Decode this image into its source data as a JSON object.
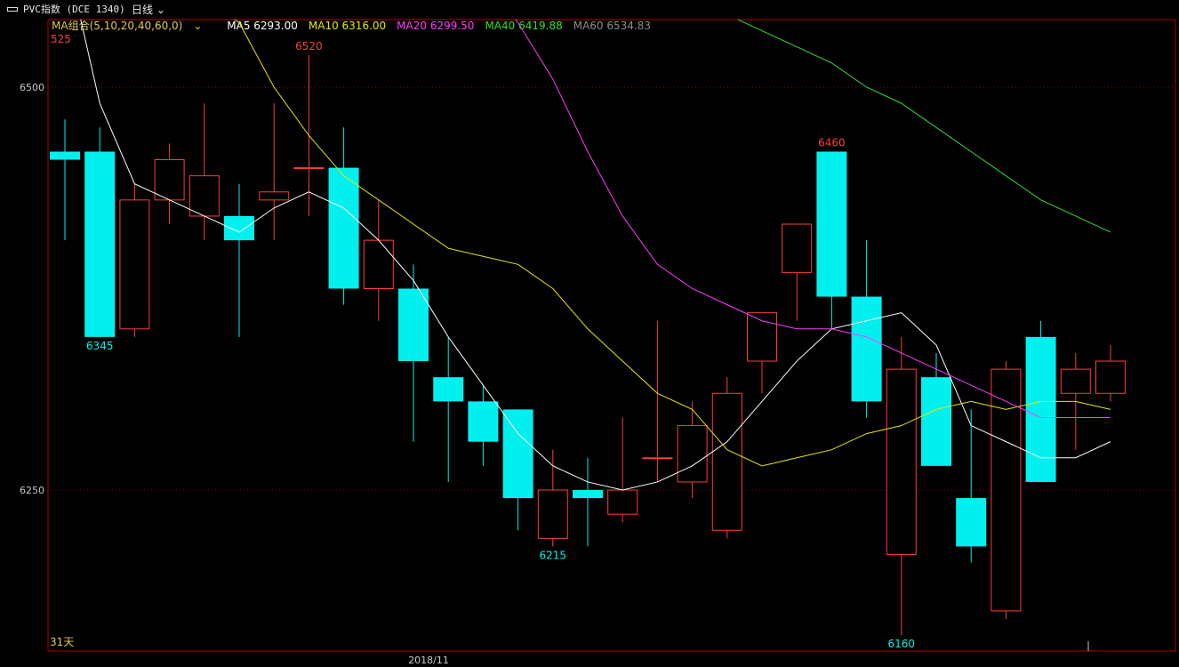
{
  "title_bar": {
    "symbol": "PVC指数 (DCE 1340)",
    "period": "日线"
  },
  "ma_bar": {
    "combo": "MA组合(5,10,20,40,60,0)",
    "items": [
      {
        "label": "MA5 6293.00",
        "color": "#ffffff"
      },
      {
        "label": "MA10 6316.00",
        "color": "#e6e600"
      },
      {
        "label": "MA20 6299.50",
        "color": "#ff3cff"
      },
      {
        "label": "MA40 6419.88",
        "color": "#32dc32"
      },
      {
        "label": "MA60 6534.83",
        "color": "#8c8c8c"
      }
    ]
  },
  "chart_data": {
    "type": "candlestick",
    "y_ticks": [
      6500,
      6250
    ],
    "ylim": [
      6150,
      6560
    ],
    "x_label": "2018/11",
    "days_label": "31天",
    "truncated_high_label": "525",
    "up_color": "#ff3c3c",
    "down_color": "#00f0f0",
    "candles": [
      {
        "o": 6460,
        "h": 6480,
        "l": 6405,
        "c": 6455
      },
      {
        "o": 6460,
        "h": 6475,
        "l": 6345,
        "c": 6345
      },
      {
        "o": 6350,
        "h": 6440,
        "l": 6345,
        "c": 6430
      },
      {
        "o": 6430,
        "h": 6465,
        "l": 6415,
        "c": 6455
      },
      {
        "o": 6420,
        "h": 6490,
        "l": 6405,
        "c": 6445
      },
      {
        "o": 6420,
        "h": 6440,
        "l": 6345,
        "c": 6405
      },
      {
        "o": 6430,
        "h": 6490,
        "l": 6405,
        "c": 6435
      },
      {
        "o": 6450,
        "h": 6520,
        "l": 6420,
        "c": 6450
      },
      {
        "o": 6450,
        "h": 6475,
        "l": 6365,
        "c": 6375
      },
      {
        "o": 6375,
        "h": 6430,
        "l": 6355,
        "c": 6405
      },
      {
        "o": 6375,
        "h": 6390,
        "l": 6280,
        "c": 6330
      },
      {
        "o": 6320,
        "h": 6345,
        "l": 6255,
        "c": 6305
      },
      {
        "o": 6305,
        "h": 6315,
        "l": 6265,
        "c": 6280
      },
      {
        "o": 6300,
        "h": 6300,
        "l": 6225,
        "c": 6245
      },
      {
        "o": 6220,
        "h": 6275,
        "l": 6215,
        "c": 6250
      },
      {
        "o": 6250,
        "h": 6270,
        "l": 6215,
        "c": 6245
      },
      {
        "o": 6235,
        "h": 6295,
        "l": 6230,
        "c": 6250
      },
      {
        "o": 6270,
        "h": 6355,
        "l": 6255,
        "c": 6270
      },
      {
        "o": 6255,
        "h": 6305,
        "l": 6245,
        "c": 6290
      },
      {
        "o": 6225,
        "h": 6320,
        "l": 6220,
        "c": 6310
      },
      {
        "o": 6330,
        "h": 6340,
        "l": 6310,
        "c": 6360
      },
      {
        "o": 6385,
        "h": 6405,
        "l": 6355,
        "c": 6415
      },
      {
        "o": 6460,
        "h": 6460,
        "l": 6350,
        "c": 6370
      },
      {
        "o": 6370,
        "h": 6405,
        "l": 6295,
        "c": 6305
      },
      {
        "o": 6210,
        "h": 6345,
        "l": 6160,
        "c": 6325
      },
      {
        "o": 6320,
        "h": 6335,
        "l": 6265,
        "c": 6265
      },
      {
        "o": 6245,
        "h": 6300,
        "l": 6205,
        "c": 6215
      },
      {
        "o": 6175,
        "h": 6330,
        "l": 6170,
        "c": 6325
      },
      {
        "o": 6345,
        "h": 6355,
        "l": 6255,
        "c": 6255
      },
      {
        "o": 6310,
        "h": 6335,
        "l": 6275,
        "c": 6325
      },
      {
        "o": 6310,
        "h": 6340,
        "l": 6305,
        "c": 6330
      }
    ],
    "ma_lines": [
      {
        "name": "MA5",
        "color": "#ffffff",
        "values": [
          6585,
          6490,
          6440,
          6430,
          6420,
          6410,
          6425,
          6435,
          6425,
          6405,
          6380,
          6345,
          6315,
          6285,
          6265,
          6255,
          6250,
          6255,
          6265,
          6280,
          6305,
          6330,
          6350,
          6355,
          6360,
          6340,
          6290,
          6280,
          6270,
          6270,
          6280
        ]
      },
      {
        "name": "MA10",
        "color": "#e6e600",
        "values": [
          null,
          null,
          null,
          null,
          6555,
          6540,
          6500,
          6470,
          6445,
          6430,
          6415,
          6400,
          6395,
          6390,
          6375,
          6350,
          6330,
          6310,
          6300,
          6275,
          6265,
          6270,
          6275,
          6285,
          6290,
          6300,
          6305,
          6300,
          6305,
          6305,
          6300
        ]
      },
      {
        "name": "MA20",
        "color": "#ff3cff",
        "values": [
          null,
          null,
          null,
          null,
          null,
          null,
          null,
          null,
          null,
          null,
          null,
          null,
          6565,
          6540,
          6505,
          6460,
          6420,
          6390,
          6375,
          6365,
          6355,
          6350,
          6350,
          6345,
          6335,
          6325,
          6315,
          6305,
          6295,
          6295,
          6295
        ]
      },
      {
        "name": "MA40",
        "color": "#32dc32",
        "values": [
          null,
          null,
          null,
          null,
          null,
          null,
          null,
          null,
          null,
          null,
          null,
          null,
          null,
          null,
          null,
          null,
          null,
          null,
          null,
          6545,
          6535,
          6525,
          6515,
          6500,
          6490,
          6475,
          6460,
          6445,
          6430,
          6420,
          6410
        ]
      }
    ],
    "annotations": [
      {
        "label": "6345",
        "candle": 1,
        "at": "low",
        "color": "#00f0f0"
      },
      {
        "label": "6520",
        "candle": 7,
        "at": "high",
        "color": "#ff3c3c"
      },
      {
        "label": "6215",
        "candle": 14,
        "at": "low",
        "color": "#00f0f0"
      },
      {
        "label": "6460",
        "candle": 22,
        "at": "high",
        "color": "#ff3c3c"
      },
      {
        "label": "6160",
        "candle": 24,
        "at": "low",
        "color": "#00f0f0"
      }
    ]
  }
}
